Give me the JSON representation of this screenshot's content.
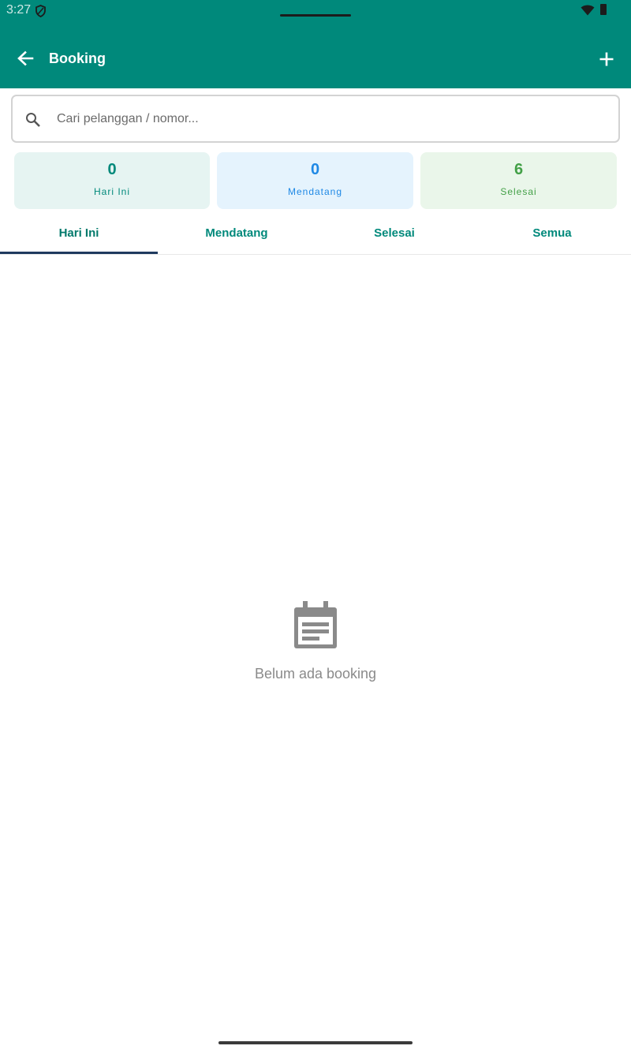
{
  "status_bar": {
    "time": "3:27"
  },
  "app_bar": {
    "title": "Booking",
    "back_icon": "arrow-back-icon",
    "add_icon": "add-icon"
  },
  "search": {
    "placeholder": "Cari pelanggan / nomor...",
    "value": "",
    "icon": "search-icon"
  },
  "stats": [
    {
      "value": "0",
      "label": "Hari Ini",
      "color": "#00897b"
    },
    {
      "value": "0",
      "label": "Mendatang",
      "color": "#1e88e5"
    },
    {
      "value": "6",
      "label": "Selesai",
      "color": "#43a047"
    }
  ],
  "tabs": [
    {
      "label": "Hari Ini",
      "active": true
    },
    {
      "label": "Mendatang",
      "active": false
    },
    {
      "label": "Selesai",
      "active": false
    },
    {
      "label": "Semua",
      "active": false
    }
  ],
  "empty_state": {
    "icon": "calendar-note-icon",
    "message": "Belum ada booking"
  },
  "colors": {
    "primary": "#00897b",
    "tab_indicator": "#1f3a5f"
  }
}
